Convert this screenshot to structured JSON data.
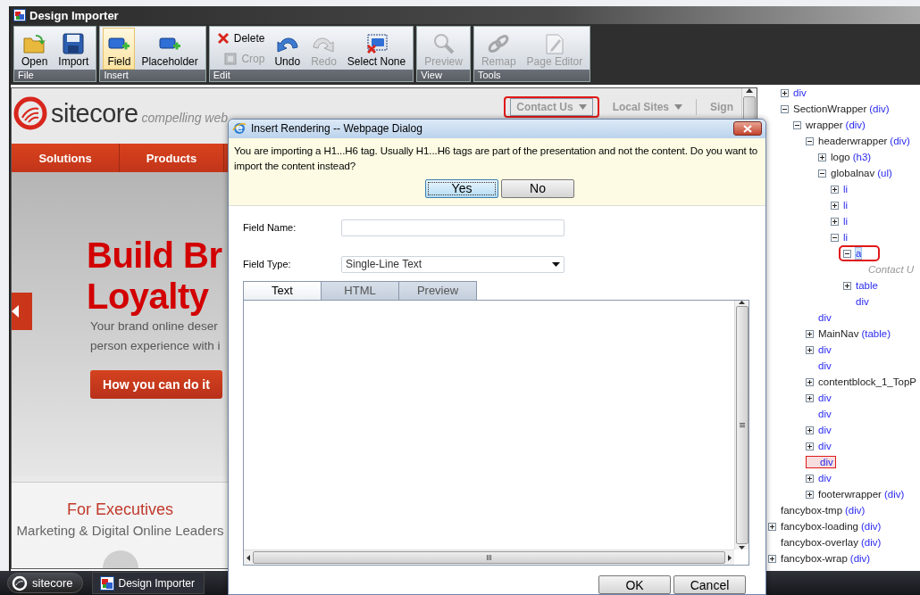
{
  "window": {
    "title": "Design Importer"
  },
  "ribbon": {
    "groups": [
      {
        "label": "File",
        "buttons": [
          {
            "label": "Open",
            "kind": "large",
            "disabled": false,
            "selected": false
          },
          {
            "label": "Import",
            "kind": "large",
            "disabled": false,
            "selected": false
          }
        ]
      },
      {
        "label": "Insert",
        "buttons": [
          {
            "label": "Field",
            "kind": "large",
            "disabled": false,
            "selected": true
          },
          {
            "label": "Placeholder",
            "kind": "large",
            "disabled": false,
            "selected": false
          }
        ]
      },
      {
        "label": "Edit",
        "buttons": [
          {
            "label": "Delete",
            "kind": "small",
            "disabled": false,
            "selected": false
          },
          {
            "label": "Crop",
            "kind": "small",
            "disabled": true,
            "selected": false
          },
          {
            "label": "Undo",
            "kind": "large",
            "disabled": false,
            "selected": false
          },
          {
            "label": "Redo",
            "kind": "large",
            "disabled": true,
            "selected": false
          },
          {
            "label": "Select None",
            "kind": "large",
            "disabled": false,
            "selected": false
          }
        ]
      },
      {
        "label": "View",
        "buttons": [
          {
            "label": "Preview",
            "kind": "large",
            "disabled": true,
            "selected": false
          }
        ]
      },
      {
        "label": "Tools",
        "buttons": [
          {
            "label": "Remap",
            "kind": "large",
            "disabled": true,
            "selected": false
          },
          {
            "label": "Page Editor",
            "kind": "large",
            "disabled": true,
            "selected": false
          }
        ]
      }
    ]
  },
  "webpage": {
    "logo": {
      "wordmark": "sitecore",
      "tagline": "compelling web"
    },
    "top_links": [
      {
        "label": "Contact Us",
        "dropdown": true,
        "annotated": true
      },
      {
        "label": "Local Sites",
        "dropdown": true,
        "annotated": false
      },
      {
        "label": "Sign",
        "dropdown": false,
        "annotated": false
      }
    ],
    "nav": [
      "Solutions",
      "Products"
    ],
    "hero": {
      "heading": [
        "Build Br",
        "Loyalty"
      ],
      "text": [
        "Your brand online deser",
        "person experience with i"
      ],
      "button": "How you can do it"
    },
    "section": {
      "title": "For Executives",
      "subtitle": "Marketing & Digital Online Leaders"
    }
  },
  "tree": {
    "items": [
      {
        "children": [
          {
            "kind": "branch",
            "tag": "div",
            "expanded": false
          },
          {
            "kind": "branch",
            "name": "SectionWrapper",
            "tag": "(div)",
            "expanded": true,
            "children": [
              {
                "kind": "branch",
                "name": "wrapper",
                "tag": "(div)",
                "expanded": true,
                "children": [
                  {
                    "kind": "branch",
                    "name": "headerwrapper",
                    "tag": "(div)",
                    "expanded": true,
                    "children": [
                      {
                        "kind": "branch",
                        "name": "logo",
                        "tag": "(h3)",
                        "expanded": false
                      },
                      {
                        "kind": "branch",
                        "name": "globalnav",
                        "tag": "(ul)",
                        "expanded": true,
                        "children": [
                          {
                            "kind": "branch",
                            "tag": "li",
                            "expanded": false
                          },
                          {
                            "kind": "branch",
                            "tag": "li",
                            "expanded": false
                          },
                          {
                            "kind": "branch",
                            "tag": "li",
                            "expanded": false
                          },
                          {
                            "kind": "branch",
                            "tag": "li",
                            "expanded": true,
                            "children": [
                              {
                                "kind": "branch",
                                "tag": "a",
                                "expanded": true,
                                "selected": true,
                                "annotated": true,
                                "children": [
                                  {
                                    "kind": "text",
                                    "name": "Contact U"
                                  }
                                ]
                              },
                              {
                                "kind": "branch",
                                "tag": "table",
                                "expanded": false
                              },
                              {
                                "kind": "leaf",
                                "tag": "div"
                              }
                            ]
                          }
                        ]
                      }
                    ]
                  },
                  {
                    "kind": "leaf",
                    "tag": "div"
                  },
                  {
                    "kind": "branch",
                    "name": "MainNav",
                    "tag": "(table)",
                    "expanded": false
                  },
                  {
                    "kind": "branch",
                    "tag": "div",
                    "expanded": false
                  },
                  {
                    "kind": "leaf",
                    "tag": "div"
                  },
                  {
                    "kind": "branch",
                    "name": "contentblock_1_TopP",
                    "expanded": false
                  },
                  {
                    "kind": "branch",
                    "tag": "div",
                    "expanded": false
                  },
                  {
                    "kind": "leaf",
                    "tag": "div"
                  },
                  {
                    "kind": "branch",
                    "tag": "div",
                    "expanded": false
                  },
                  {
                    "kind": "branch",
                    "tag": "div",
                    "expanded": false
                  },
                  {
                    "kind": "leaf",
                    "tag": "div",
                    "annotated": true
                  },
                  {
                    "kind": "branch",
                    "tag": "div",
                    "expanded": false
                  },
                  {
                    "kind": "branch",
                    "name": "footerwrapper",
                    "tag": "(div)",
                    "expanded": false
                  }
                ]
              }
            ]
          }
        ]
      },
      {
        "kind": "leaf",
        "name": "fancybox-tmp",
        "tag": "(div)"
      },
      {
        "kind": "branch",
        "name": "fancybox-loading",
        "tag": "(div)",
        "expanded": false
      },
      {
        "kind": "leaf",
        "name": "fancybox-overlay",
        "tag": "(div)"
      },
      {
        "kind": "branch",
        "name": "fancybox-wrap",
        "tag": "(div)",
        "expanded": false
      }
    ]
  },
  "dialog": {
    "title": "Insert Rendering -- Webpage Dialog",
    "notice": {
      "message": "You are importing a H1...H6 tag. Usually H1...H6 tags are part of the presentation and not the content. Do you want to import the content instead?",
      "buttons": [
        {
          "label": "Yes",
          "focused": true
        },
        {
          "label": "No",
          "focused": false
        }
      ]
    },
    "fields": [
      {
        "label": "Field Name:",
        "kind": "text"
      },
      {
        "label": "Field Type:",
        "kind": "select",
        "value": "Single-Line Text"
      }
    ],
    "tabs": [
      {
        "label": "Text",
        "selected": true
      },
      {
        "label": "HTML",
        "selected": false
      },
      {
        "label": "Preview",
        "selected": false
      }
    ],
    "buttons": [
      "OK",
      "Cancel"
    ]
  },
  "taskbar": {
    "start": "sitecore",
    "tasks": [
      "Design Importer"
    ]
  }
}
